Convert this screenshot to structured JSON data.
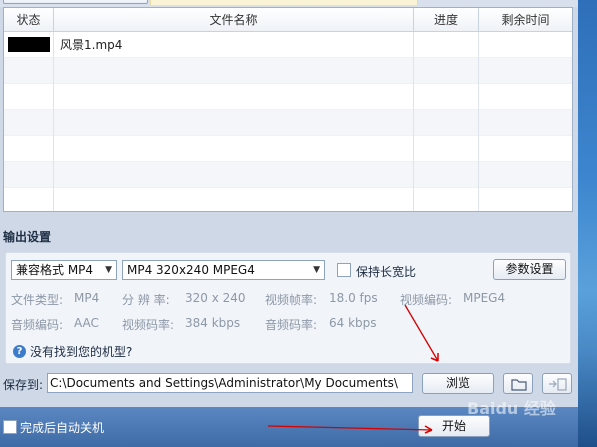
{
  "table": {
    "headers": {
      "status": "状态",
      "filename": "文件名称",
      "progress": "进度",
      "remaining": "剩余时间"
    },
    "rows": [
      {
        "filename": "风景1.mp4",
        "progress": "",
        "remaining": ""
      }
    ],
    "empty_rows": 6
  },
  "output": {
    "title": "输出设置",
    "format_select": "兼容格式 MP4",
    "preset_select": "MP4 320x240 MPEG4",
    "keep_ratio_label": "保持长宽比",
    "params_button": "参数设置",
    "info": {
      "file_type_label": "文件类型:",
      "file_type_value": "MP4",
      "resolution_label": "分 辨 率:",
      "resolution_value": "320 x 240",
      "framerate_label": "视频帧率:",
      "framerate_value": "18.0 fps",
      "vcodec_label": "视频编码:",
      "vcodec_value": "MPEG4",
      "acodec_label": "音频编码:",
      "acodec_value": "AAC",
      "vbitrate_label": "视频码率:",
      "vbitrate_value": "384 kbps",
      "abitrate_label": "音频码率:",
      "abitrate_value": "64 kbps"
    },
    "help_link": "没有找到您的机型?"
  },
  "save": {
    "label": "保存到:",
    "path": "C:\\Documents and Settings\\Administrator\\My Documents\\",
    "browse_button": "浏览"
  },
  "bottom": {
    "shutdown_label": "完成后自动关机",
    "start_button": "开始"
  },
  "watermark": "Baidu 经验",
  "colors": {
    "bottom_bar": "#4a77b4",
    "annotation_arrow": "#d40000"
  }
}
